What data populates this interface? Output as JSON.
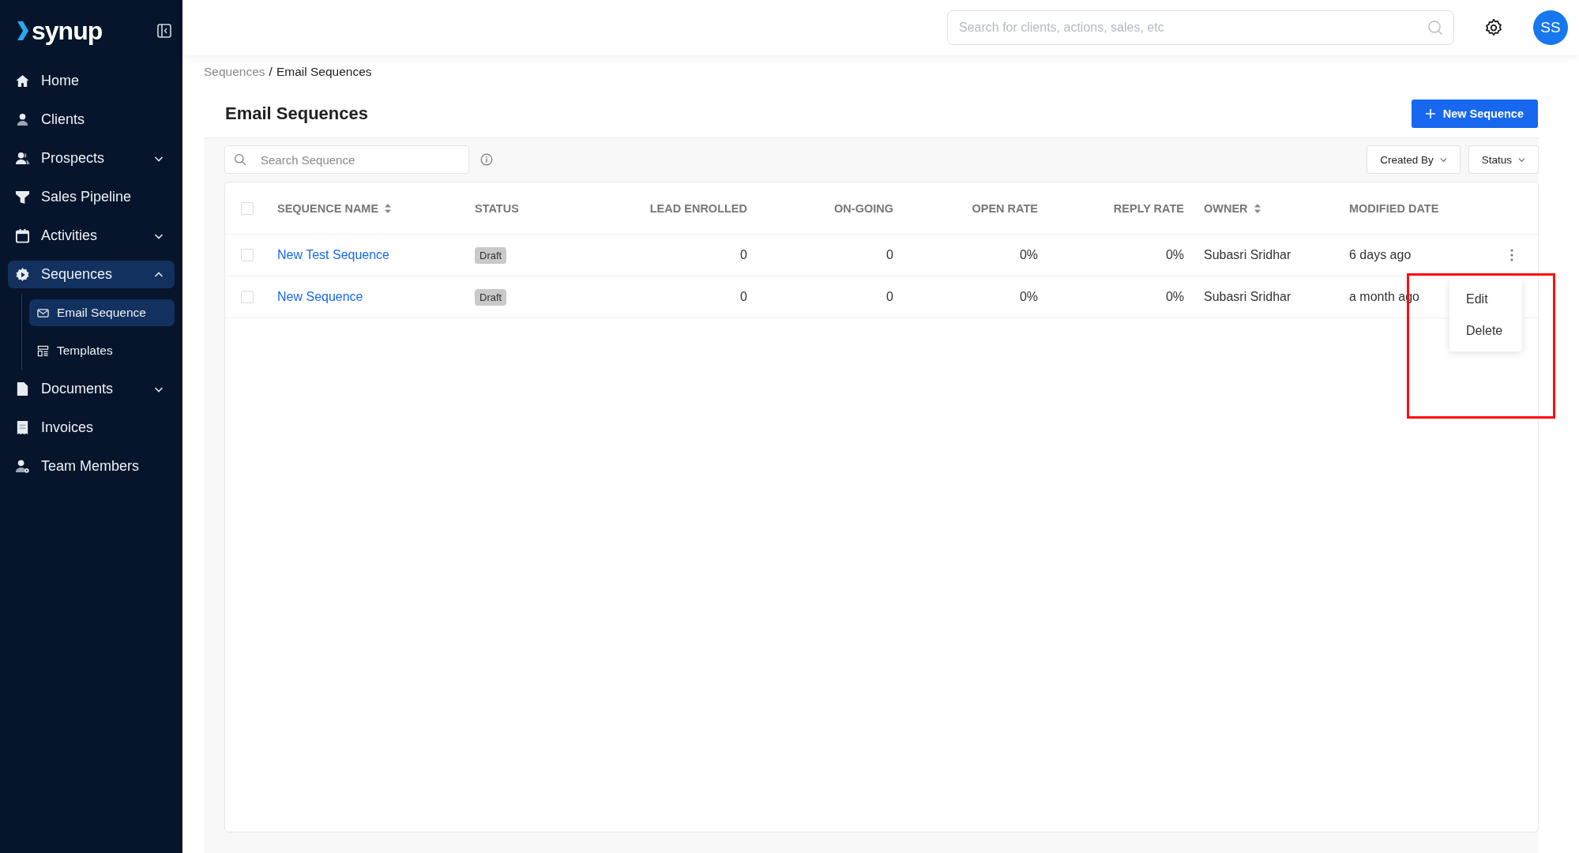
{
  "app": {
    "logo": "synup"
  },
  "header": {
    "search": {
      "placeholder": "Search for clients, actions, sales, etc"
    },
    "avatar": "SS"
  },
  "sidebar": {
    "items": [
      {
        "label": "Home",
        "selected": false
      },
      {
        "label": "Clients",
        "selected": false
      },
      {
        "label": "Prospects",
        "selected": false,
        "expanded": false
      },
      {
        "label": "Sales Pipeline",
        "selected": false
      },
      {
        "label": "Activities",
        "selected": false,
        "expanded": false
      },
      {
        "label": "Sequences",
        "selected": true,
        "expanded": true,
        "children": [
          {
            "label": "Email Sequence",
            "selected": true
          },
          {
            "label": "Templates",
            "selected": false
          }
        ]
      },
      {
        "label": "Documents",
        "selected": false,
        "expanded": false
      },
      {
        "label": "Invoices",
        "selected": false
      },
      {
        "label": "Team Members",
        "selected": false
      }
    ]
  },
  "breadcrumb": {
    "items": [
      "Sequences",
      "Email Sequences"
    ],
    "separator": "/"
  },
  "page": {
    "title": "Email Sequences",
    "new_button": "New Sequence"
  },
  "toolbar": {
    "search": {
      "placeholder": "Search Sequence"
    },
    "filters": [
      "Created By",
      "Status"
    ]
  },
  "table": {
    "all_checked": false,
    "columns": [
      {
        "label": "SEQUENCE NAME",
        "kind": "text",
        "sortable": true
      },
      {
        "label": "STATUS",
        "kind": "text",
        "sortable": false
      },
      {
        "label": "LEAD ENROLLED",
        "kind": "number",
        "sortable": false
      },
      {
        "label": "ON-GOING",
        "kind": "number",
        "sortable": false
      },
      {
        "label": "OPEN RATE",
        "kind": "number",
        "sortable": false
      },
      {
        "label": "REPLY RATE",
        "kind": "number",
        "sortable": false
      },
      {
        "label": "OWNER",
        "kind": "text",
        "sortable": true
      },
      {
        "label": "MODIFIED DATE",
        "kind": "text",
        "sortable": false
      }
    ],
    "rows": [
      {
        "checked": false,
        "menu_open": true,
        "cells": [
          "New Test Sequence",
          "Draft",
          "0",
          "0",
          "0%",
          "0%",
          "Subasri Sridhar",
          "6 days ago"
        ]
      },
      {
        "checked": false,
        "menu_open": false,
        "cells": [
          "New Sequence",
          "Draft",
          "0",
          "0",
          "0%",
          "0%",
          "Subasri Sridhar",
          "a month ago"
        ]
      }
    ]
  },
  "row_menu": {
    "items": [
      "Edit",
      "Delete"
    ]
  }
}
